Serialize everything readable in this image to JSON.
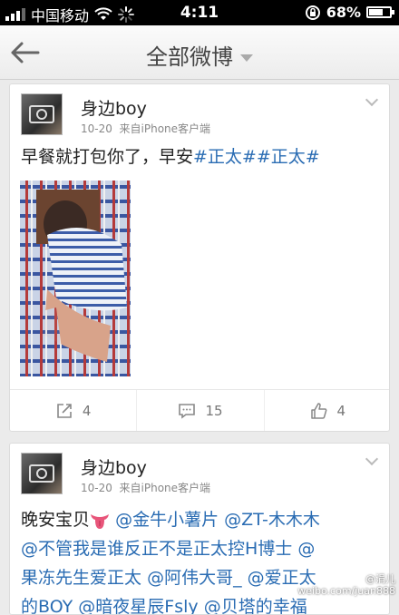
{
  "status_bar": {
    "carrier": "中国移动",
    "time": "4:11",
    "battery": "68%",
    "battery_level": 0.68
  },
  "nav": {
    "title": "全部微博"
  },
  "posts": [
    {
      "user": "身边boy",
      "date": "10-20",
      "source": "来自iPhone客户端",
      "text_plain": "早餐就打包你了，早安",
      "tags": [
        "#正太#",
        "#正太#"
      ],
      "actions": {
        "repost": "4",
        "comment": "15",
        "like": "4"
      }
    },
    {
      "user": "身边boy",
      "date": "10-20",
      "source": "来自iPhone客户端",
      "line1_plain": "晚安宝贝",
      "line1_links": [
        "@金牛小薯片",
        "@ZT-木木木"
      ],
      "line2": [
        "@不管我是谁反正不是正太控H博士",
        "@"
      ],
      "line3": [
        "果冻先生爱正太",
        "@阿伟大哥_",
        "@爱正太"
      ],
      "line4": [
        "的BOY",
        "@暗夜星辰Fsly",
        "@贝塔的幸福"
      ]
    }
  ],
  "watermark": {
    "line1": "@涓儿",
    "line2": "weibo.com/juan888"
  },
  "colors": {
    "link": "#2a6cb3",
    "nav_bg": "#f4f4f4"
  },
  "icons": [
    "back-arrow-icon",
    "dropdown-caret-icon",
    "chevron-down-icon",
    "repost-icon",
    "comment-icon",
    "like-icon"
  ]
}
